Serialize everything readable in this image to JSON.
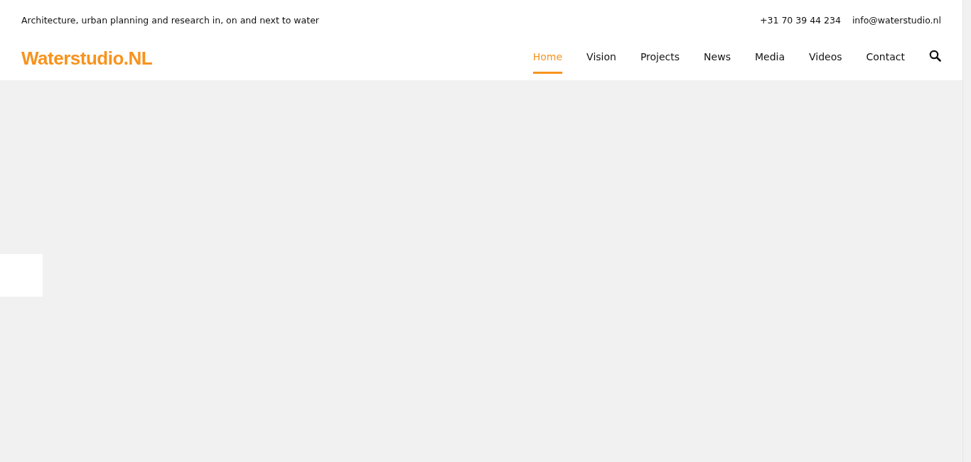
{
  "tagline": "Architecture, urban planning and research in, on and next to water",
  "contact": {
    "phone": "+31 70 39 44 234",
    "email": "info@waterstudio.nl"
  },
  "logo": "Waterstudio.NL",
  "nav": [
    {
      "label": "Home",
      "selected": true
    },
    {
      "label": "Vision",
      "selected": false
    },
    {
      "label": "Projects",
      "selected": false
    },
    {
      "label": "News",
      "selected": false
    },
    {
      "label": "Media",
      "selected": false
    },
    {
      "label": "Videos",
      "selected": false
    },
    {
      "label": "Contact",
      "selected": false
    }
  ]
}
